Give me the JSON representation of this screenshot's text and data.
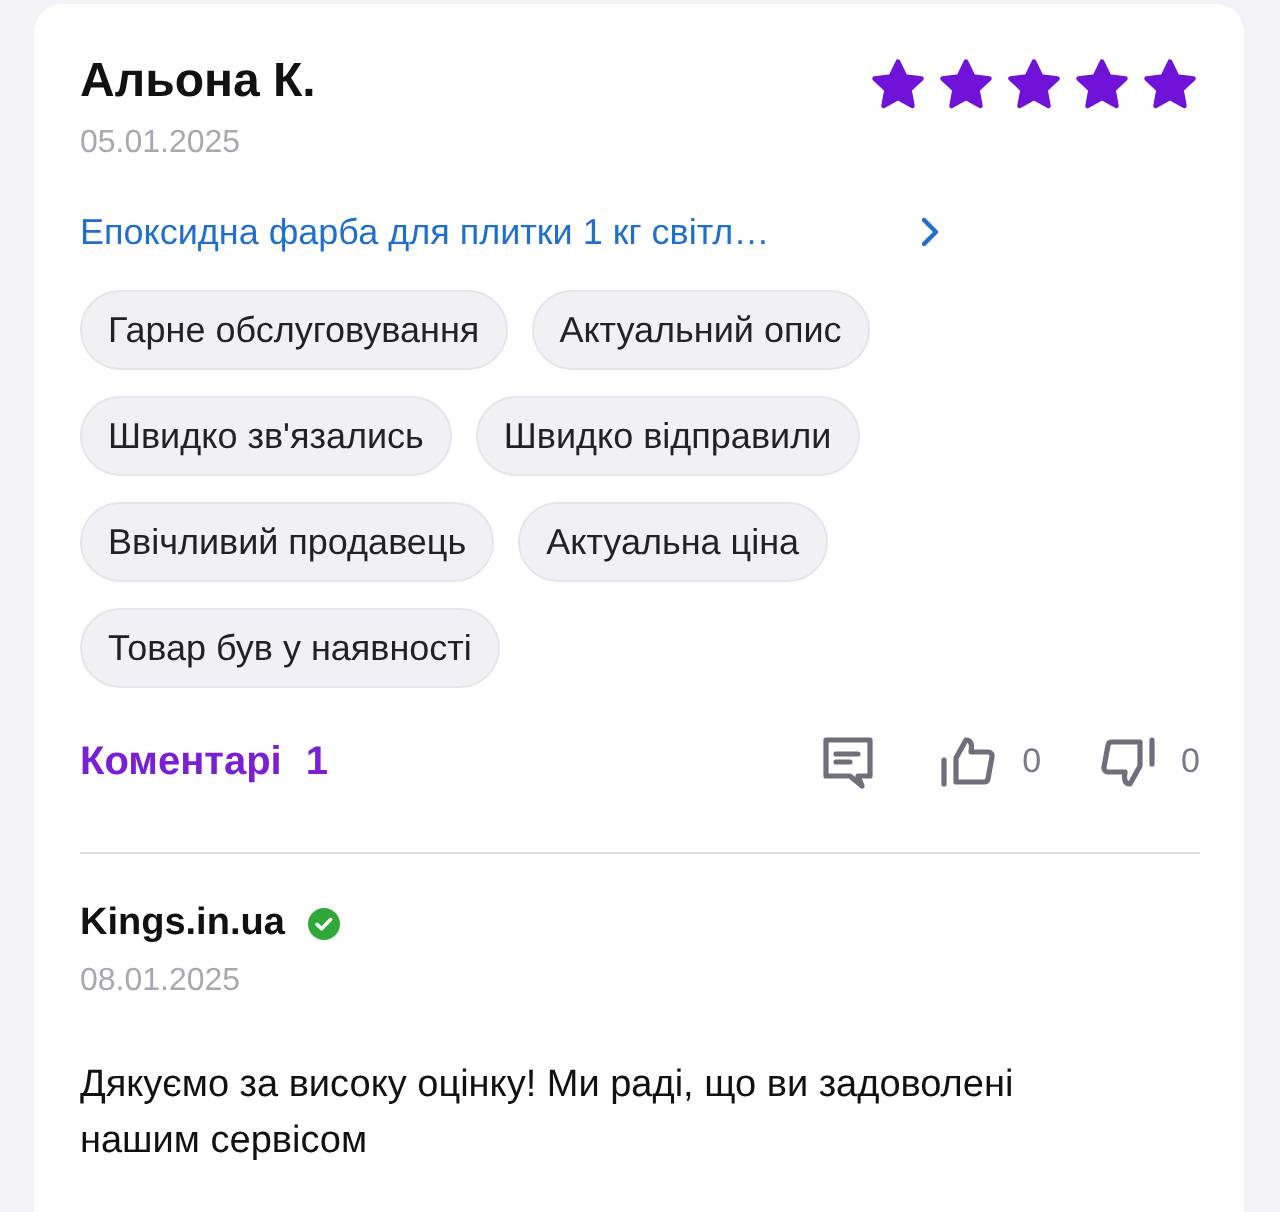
{
  "review": {
    "author": "Альона К.",
    "date": "05.01.2025",
    "stars": 5,
    "product_link": "Епоксидна фарба для плитки 1 кг світл…",
    "tags": [
      "Гарне обслуговування",
      "Актуальний опис",
      "Швидко зв'язались",
      "Швидко відправили",
      "Ввічливий продавець",
      "Актуальна ціна",
      "Товар був у наявності"
    ],
    "comments_label": "Коментарі",
    "comments_count": "1",
    "likes": "0",
    "dislikes": "0"
  },
  "reply": {
    "author": "Kings.in.ua",
    "verified": true,
    "date": "08.01.2025",
    "text": "Дякуємо за високу оцінку! Ми раді, що ви задоволені нашим сервісом"
  }
}
